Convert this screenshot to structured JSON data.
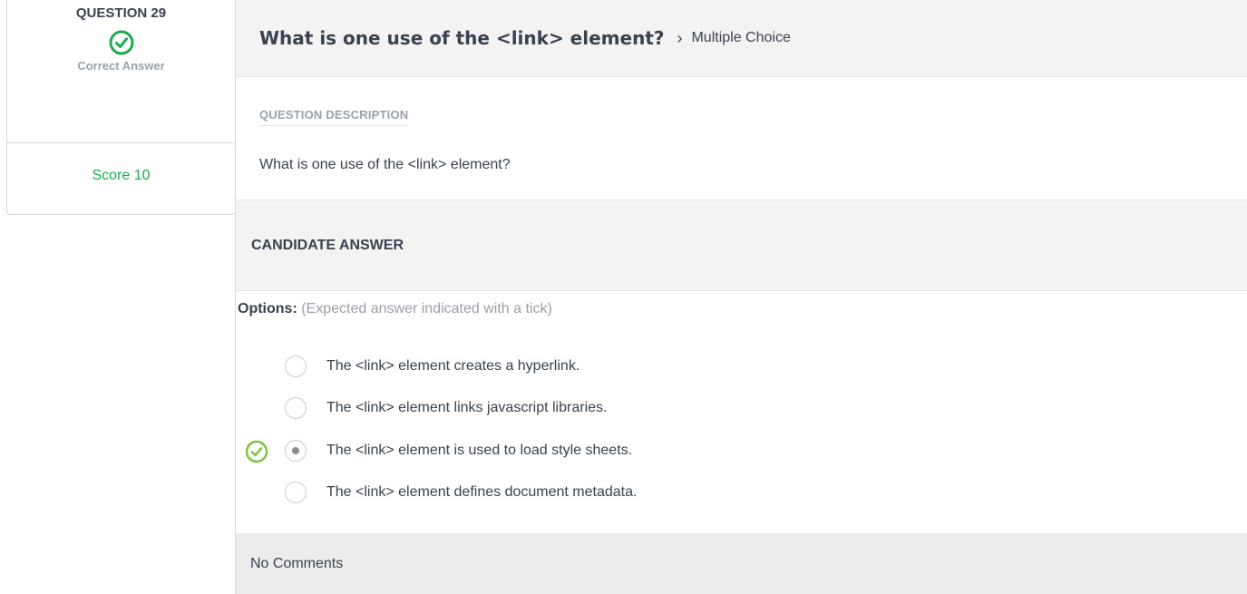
{
  "summary": {
    "question_number": "QUESTION 29",
    "status_label": "Correct Answer",
    "score": "Score 10",
    "status_icon": "check-circle-icon",
    "accent_color": "#1ba94c"
  },
  "header": {
    "title": "What is one use of the <link> element?",
    "separator": "›",
    "question_type": "Multiple Choice"
  },
  "description": {
    "heading": "QUESTION DESCRIPTION",
    "text": "What is one use of the <link> element?"
  },
  "answer": {
    "heading": "CANDIDATE ANSWER",
    "options_label": "Options:",
    "options_hint": "(Expected answer indicated with a tick)",
    "options": [
      {
        "text": "The <link> element creates a hyperlink.",
        "selected": false,
        "expected": false
      },
      {
        "text": "The <link> element links javascript libraries.",
        "selected": false,
        "expected": false
      },
      {
        "text": "The <link> element is used to load style sheets.",
        "selected": true,
        "expected": true
      },
      {
        "text": "The <link> element defines document metadata.",
        "selected": false,
        "expected": false
      }
    ]
  },
  "comments": {
    "text": "No Comments"
  }
}
